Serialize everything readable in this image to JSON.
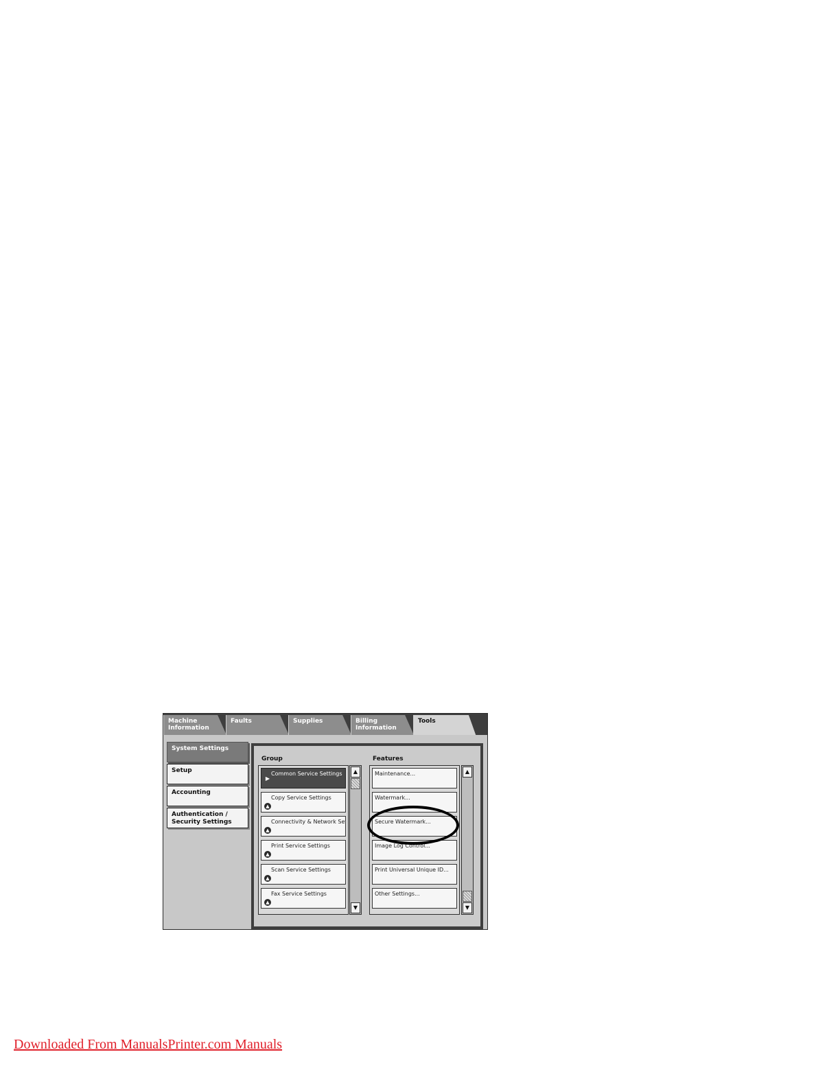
{
  "tabs": [
    {
      "label": "Machine\nInformation",
      "active": false
    },
    {
      "label": "Faults",
      "active": false
    },
    {
      "label": "Supplies",
      "active": false
    },
    {
      "label": "Billing\nInformation",
      "active": false
    },
    {
      "label": "Tools",
      "active": true
    }
  ],
  "sidebar": {
    "items": [
      {
        "label": "System Settings",
        "selected": true
      },
      {
        "label": "Setup",
        "selected": false
      },
      {
        "label": "Accounting",
        "selected": false
      },
      {
        "label": "Authentication /\nSecurity Settings",
        "selected": false
      }
    ]
  },
  "group": {
    "title": "Group",
    "items": [
      {
        "label": "Common Service Settings",
        "glyph": "▶",
        "selected": true
      },
      {
        "label": "Copy Service Settings",
        "glyph": "▲",
        "selected": false
      },
      {
        "label": "Connectivity & Network Setup",
        "glyph": "▲",
        "selected": false
      },
      {
        "label": "Print Service Settings",
        "glyph": "▲",
        "selected": false
      },
      {
        "label": "Scan Service Settings",
        "glyph": "▲",
        "selected": false
      },
      {
        "label": "Fax Service Settings",
        "glyph": "▲",
        "selected": false
      }
    ]
  },
  "features": {
    "title": "Features",
    "items": [
      {
        "label": "Maintenance..."
      },
      {
        "label": "Watermark..."
      },
      {
        "label": "Secure Watermark..."
      },
      {
        "label": "Image Log Control..."
      },
      {
        "label": "Print Universal Unique ID..."
      },
      {
        "label": "Other Settings..."
      }
    ]
  },
  "scroll": {
    "up_glyph": "▲",
    "down_glyph": "▼"
  },
  "footer": {
    "link_text": "Downloaded From ManualsPrinter.com Manuals",
    "link_color": "#e0202a"
  }
}
